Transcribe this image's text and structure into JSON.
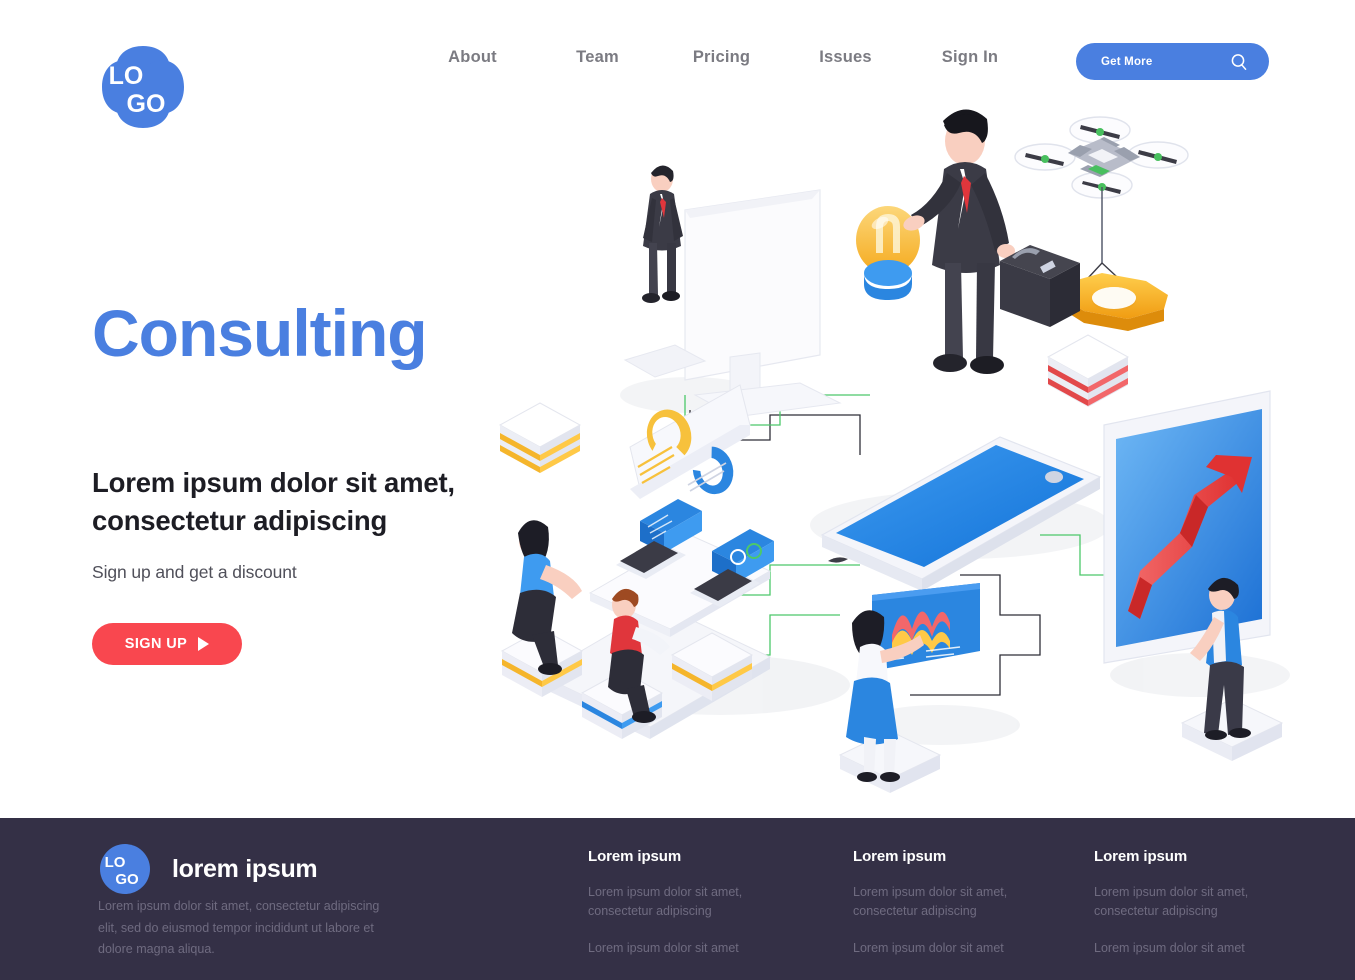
{
  "header": {
    "logo": {
      "line1": "LO",
      "line2": "GO",
      "name": "logo"
    },
    "nav": [
      {
        "label": "About"
      },
      {
        "label": "Team"
      },
      {
        "label": "Pricing"
      },
      {
        "label": "Issues"
      },
      {
        "label": "Sign In"
      }
    ],
    "cta": {
      "label": "Get More",
      "icon": "search-icon"
    }
  },
  "hero": {
    "title": "Consulting",
    "subtitle": "Lorem ipsum dolor sit amet, consectetur adipiscing",
    "description": "Sign up and get a discount",
    "button": {
      "label": "SIGN UP",
      "icon": "play-icon"
    }
  },
  "illustration": {
    "name": "isometric-consulting-illustration",
    "elements": [
      "desktop-monitor",
      "businessman-presenter",
      "lightbulb-icon",
      "quadcopter-drone",
      "gear-icon",
      "smartphone-platform",
      "donut-chart-panel",
      "team-workspace",
      "analytics-screen",
      "growth-chart-screen",
      "stacked-blocks-yellow",
      "stacked-blocks-red"
    ]
  },
  "footer": {
    "logo": {
      "line1": "LO",
      "line2": "GO"
    },
    "brand": "lorem ipsum",
    "about": "Lorem ipsum dolor sit amet, consectetur adipiscing elit, sed do eiusmod tempor incididunt ut labore et dolore magna aliqua.",
    "columns": [
      {
        "title": "Lorem ipsum",
        "links": [
          "Lorem ipsum dolor sit amet, consectetur adipiscing",
          "Lorem ipsum dolor sit amet"
        ]
      },
      {
        "title": "Lorem ipsum",
        "links": [
          "Lorem ipsum dolor sit amet, consectetur adipiscing",
          "Lorem ipsum dolor sit amet"
        ]
      },
      {
        "title": "Lorem ipsum",
        "links": [
          "Lorem ipsum dolor sit amet, consectetur adipiscing",
          "Lorem ipsum dolor sit amet"
        ]
      }
    ]
  },
  "colors": {
    "brand_blue": "#4a7fe0",
    "accent_red": "#f9474f",
    "footer_bg": "#343046",
    "nav_text": "#7b7b82",
    "heading_dark": "#1d1d24",
    "muted": "#6f6b80",
    "gear_yellow": "#f6b221",
    "green_line": "#4cc86a"
  }
}
